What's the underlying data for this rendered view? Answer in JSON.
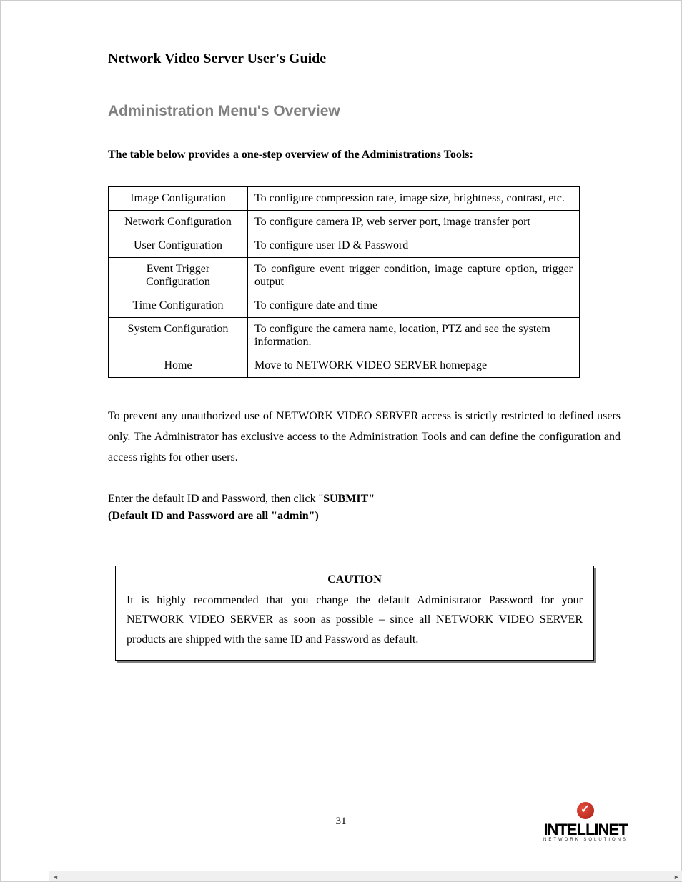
{
  "page_title": "Network Video Server User's Guide",
  "section_heading": "Administration Menu's Overview",
  "intro": "The table below provides a one-step overview of the Administrations Tools:",
  "table": [
    {
      "name": "Image Configuration",
      "desc": "To configure compression rate, image size, brightness, contrast, etc."
    },
    {
      "name": "Network Configuration",
      "desc": "To configure camera IP, web server port, image transfer port"
    },
    {
      "name": "User Configuration",
      "desc": "To configure user ID & Password"
    },
    {
      "name": "Event Trigger Configuration",
      "desc": "To configure event trigger condition, image capture option, trigger output"
    },
    {
      "name": "Time Configuration",
      "desc": "To configure date and time"
    },
    {
      "name": "System Configuration",
      "desc": "To configure the camera name, location, PTZ and see the system information."
    },
    {
      "name": "Home",
      "desc": "Move to NETWORK VIDEO SERVER homepage"
    }
  ],
  "body_para": "To prevent any unauthorized use of NETWORK VIDEO SERVER access is strictly restricted to defined users only. The Administrator has exclusive access to the Administration Tools and can define the configuration and access rights for other users.",
  "submit_prefix": "Enter the default ID and Password, then click \"",
  "submit_label": "SUBMIT\"",
  "default_note": "(Default ID and Password are all \"admin\")",
  "caution": {
    "title": "CAUTION",
    "text": "It is highly recommended that you change the default Administrator Password for your NETWORK VIDEO SERVER as soon as possible – since all NETWORK VIDEO SERVER products are shipped with the same ID and Password as default."
  },
  "page_number": "31",
  "logo": {
    "name": "INTELLINET",
    "sub": "NETWORK SOLUTIONS"
  }
}
